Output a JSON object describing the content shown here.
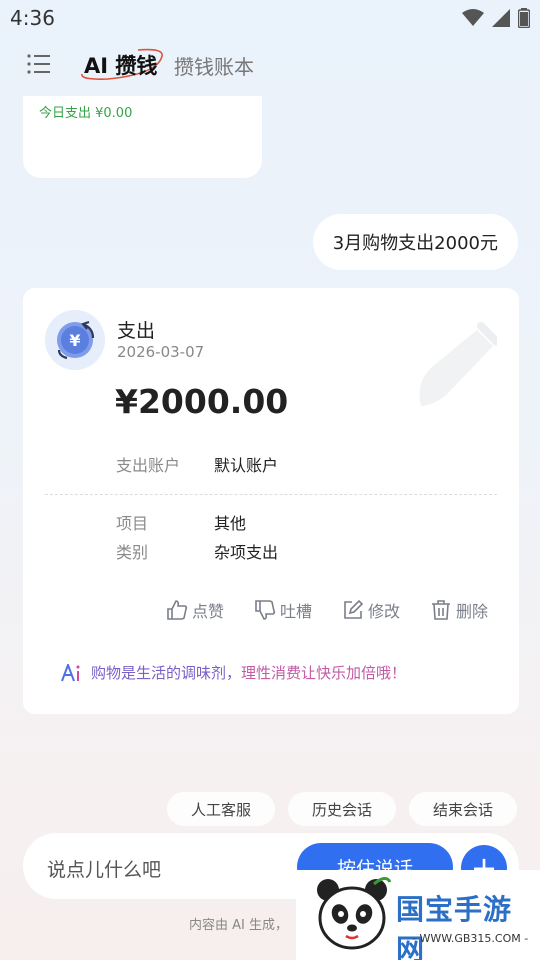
{
  "status_bar": {
    "time": "4:36"
  },
  "header": {
    "tab_active": "AI 攒钱",
    "tab_inactive": "攒钱账本"
  },
  "prev_card": {
    "today_expense": "今日支出  ¥0.00"
  },
  "user_message": "3月购物支出2000元",
  "record": {
    "type": "支出",
    "date": "2026-03-07",
    "amount": "¥2000.00",
    "account_label": "支出账户",
    "account_value": "默认账户",
    "item_label": "项目",
    "item_value": "其他",
    "category_label": "类别",
    "category_value": "杂项支出",
    "icon": "yuan-refresh-icon"
  },
  "actions": {
    "like": "点赞",
    "complain": "吐槽",
    "edit": "修改",
    "delete": "删除"
  },
  "tip": {
    "part1": "购物是生活的调味剂，",
    "part2": "理性消费让快乐加倍哦！"
  },
  "quick_actions": [
    "人工客服",
    "历史会话",
    "结束会话"
  ],
  "input": {
    "placeholder": "说点儿什么吧",
    "hold_to_talk": "按住说话"
  },
  "disclaimer": "内容由 AI 生成，",
  "watermark": {
    "title": "国宝手游网",
    "url": "- WWW.GB315.COM -"
  },
  "colors": {
    "accent": "#2f6ff0",
    "income_green": "#36a34a",
    "tip_purple": "#7a5fc8",
    "tip_pink": "#c25aa6"
  }
}
